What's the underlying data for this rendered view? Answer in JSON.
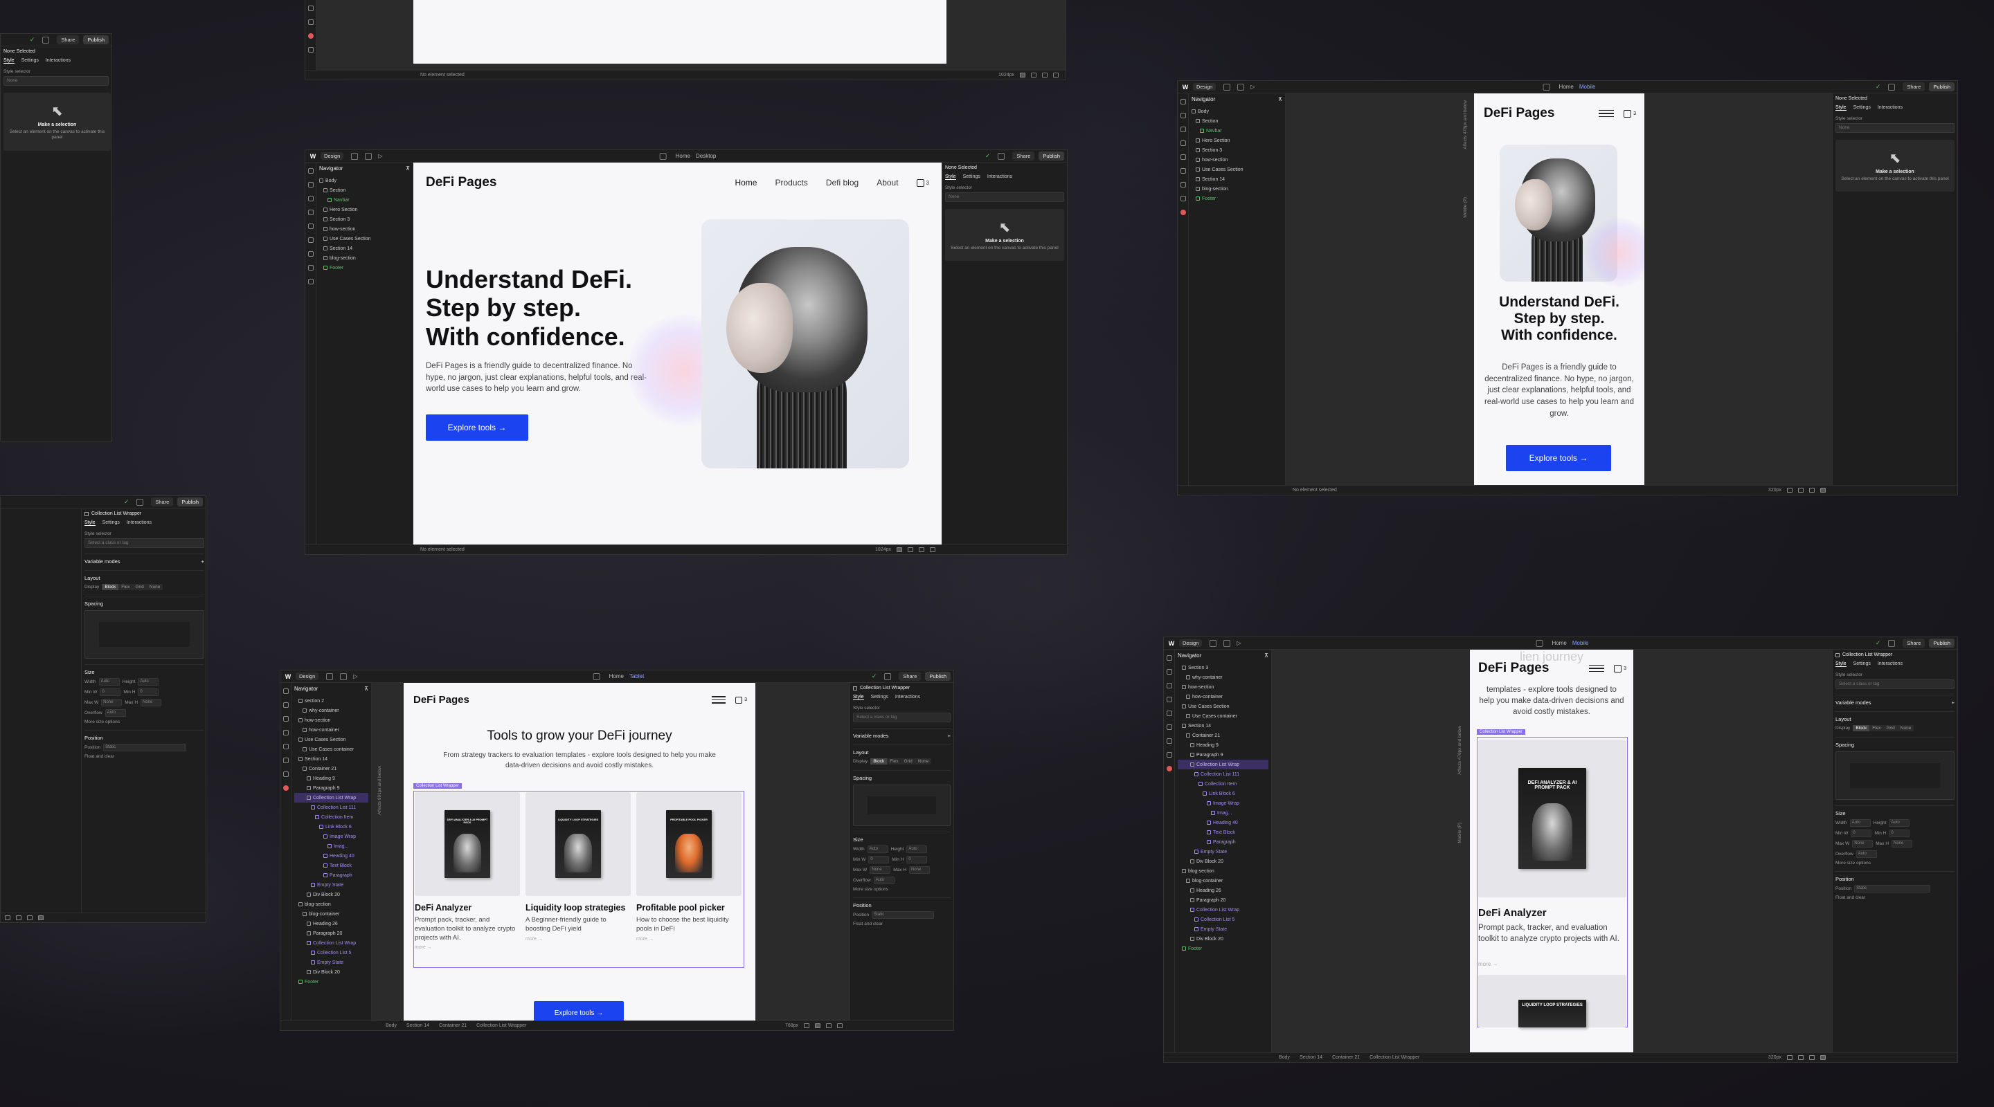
{
  "app": {
    "share": "Share",
    "publish": "Publish",
    "design": "Design",
    "home": "Home",
    "desktop": "Desktop",
    "mobile": "Mobile",
    "tablet": "Tablet",
    "navigator": "Navigator",
    "none_selected": "None Selected",
    "no_element_selected": "No element selected",
    "tabs": [
      "Style",
      "Settings",
      "Interactions"
    ],
    "style_selector": "Style selector",
    "none": "None",
    "make_selection": "Make a selection",
    "make_selection_hint": "Select an element on the canvas to activate this panel",
    "collection_list_wrapper": "Collection List Wrapper",
    "select_class": "Select a class or tag",
    "variable_modes": "Variable modes",
    "layout": "Layout",
    "display": "Display",
    "display_opts": [
      "Block",
      "Flex",
      "Grid",
      "None"
    ],
    "spacing": "Spacing",
    "size": "Size",
    "width": "Width",
    "height": "Height",
    "min_w": "Min W",
    "min_h": "Min H",
    "max_w": "Max W",
    "max_h": "Max H",
    "overflow": "Overflow",
    "auto": "Auto",
    "more_size": "More size options",
    "position": "Position",
    "static": "Static",
    "float_clear": "Float and clear",
    "zero": "0",
    "px": "PX",
    "margin": "MARGIN",
    "padding": "PADDING",
    "affects_991": "Affects 991px and below",
    "affects_478": "Affects 478px and below",
    "mobile_p": "Mobile (P)",
    "width_1024": "1024px",
    "width_320": "320px",
    "width_768": "768px"
  },
  "nav_desktop": [
    "Body",
    "Section",
    "Navbar",
    "Hero Section",
    "Section 3",
    "how-section",
    "Use Cases Section",
    "Section 14",
    "blog-section",
    "Footer"
  ],
  "nav_tablet": [
    "section 2",
    "why-container",
    "how-section",
    "how-container",
    "Use Cases Section",
    "Use Cases container",
    "Section 14",
    "Container 21",
    "Heading 9",
    "Paragraph 9",
    "Collection List Wrap",
    "Collection List 111",
    "Collection Item",
    "Link Block 6",
    "Image Wrap",
    "Imag...",
    "Heading 40",
    "Text Block",
    "Paragraph",
    "Empty State",
    "Div Block 20",
    "blog-section",
    "blog-container",
    "Heading 26",
    "Paragraph 20",
    "Collection List Wrap",
    "Collection List 5",
    "Empty State",
    "Div Block 20",
    "Footer"
  ],
  "nav_mobile2": [
    "Section 3",
    "why-container",
    "how-section",
    "how-container",
    "Use Cases Section",
    "Use Cases container",
    "Section 14",
    "Container 21",
    "Heading 9",
    "Paragraph 9",
    "Collection List Wrap",
    "Collection List 111",
    "Collection Item",
    "Link Block 6",
    "Image Wrap",
    "Imag...",
    "Heading 40",
    "Text Block",
    "Paragraph",
    "Empty State",
    "Div Block 20",
    "blog-section",
    "blog-container",
    "Heading 26",
    "Paragraph 20",
    "Collection List Wrap",
    "Collection List 5",
    "Empty State",
    "Div Block 20",
    "Footer"
  ],
  "breadcrumbs": [
    "Body",
    "Section 14",
    "Container 21",
    "Collection List Wrapper"
  ],
  "site": {
    "brand": "DeFi Pages",
    "links": [
      "Home",
      "Products",
      "Defi blog",
      "About"
    ],
    "cart_count": "3",
    "hero_title_1": "Understand DeFi.",
    "hero_title_2": "Step by step.",
    "hero_title_3": "With confidence.",
    "hero_text": "DeFi Pages is a friendly guide to decentralized finance. No hype, no jargon, just clear explanations, helpful tools, and real-world use cases to help you learn and grow.",
    "cta": "Explore tools",
    "arrow": "→",
    "tools_title": "Tools to grow your DeFi journey",
    "tools_text": "From strategy trackers to evaluation templates - explore tools designed to help you make data-driven decisions and avoid costly mistakes.",
    "tools_text_partial": "templates - explore tools designed to help you make data-driven decisions and avoid costly mistakes.",
    "more": "more →",
    "cards": [
      {
        "title": "DeFi Analyzer",
        "text": "Prompt pack, tracker, and evaluation toolkit to analyze crypto projects with AI.",
        "book": "DEFI ANALYZER & AI PROMPT PACK"
      },
      {
        "title": "Liquidity loop strategies",
        "text": "A Beginner-friendly guide to boosting DeFi yield",
        "book": "LIQUIDITY LOOP STRATEGIES"
      },
      {
        "title": "Profitable pool picker",
        "text": "How to choose the best liquidity pools in DeFi",
        "book": "PROFITABLE POOL PICKER"
      }
    ],
    "partial_heading": "lien journey"
  },
  "colors": {
    "accent": "#1b44f0",
    "selection": "#8a6cf0",
    "bg": "#1c1b22"
  }
}
